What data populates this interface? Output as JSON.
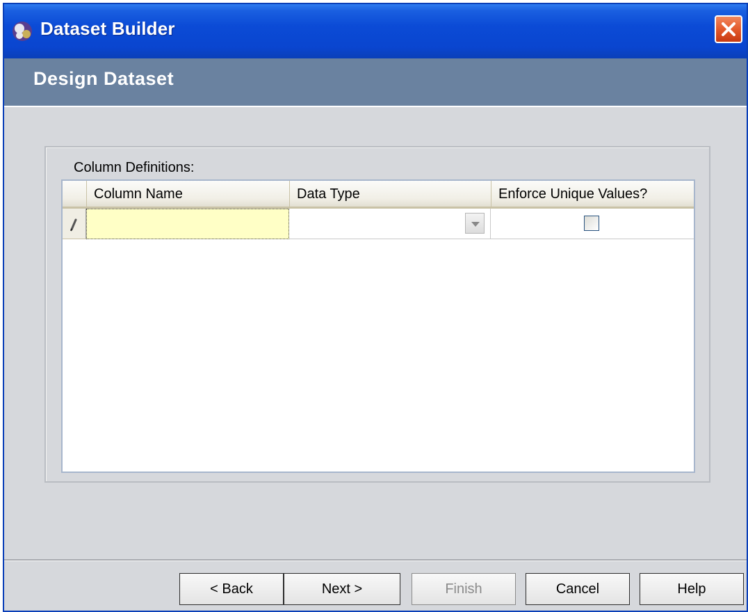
{
  "window": {
    "title": "Dataset Builder",
    "close_icon": "close-icon"
  },
  "header": {
    "title": "Design Dataset"
  },
  "group": {
    "label": "Column Definitions:"
  },
  "grid": {
    "columns": [
      "Column Name",
      "Data Type",
      "Enforce Unique Values?"
    ],
    "rows": [
      {
        "column_name": "",
        "data_type": "",
        "enforce_unique": false,
        "row_indicator_icon": "pencil-edit-icon"
      }
    ]
  },
  "buttons": {
    "back": "< Back",
    "next": "Next >",
    "finish": "Finish",
    "cancel": "Cancel",
    "help": "Help"
  },
  "colors": {
    "titlebar": "#0a45cf",
    "header_band": "#6a82a0",
    "active_cell": "#ffffc6"
  }
}
